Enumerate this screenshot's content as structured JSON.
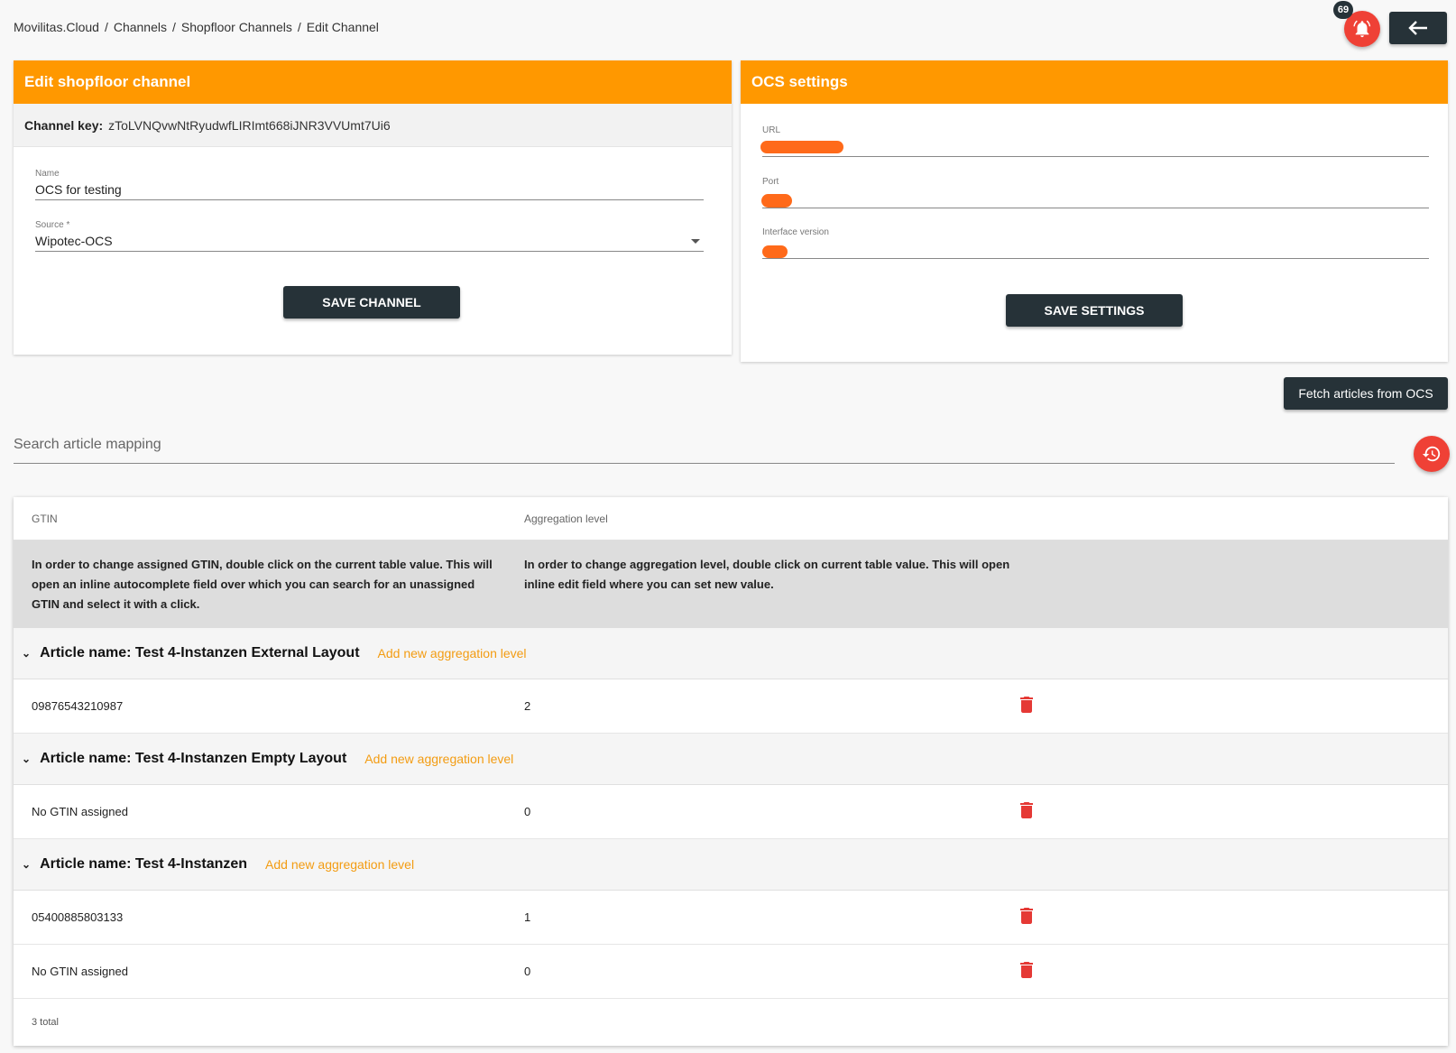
{
  "breadcrumb": [
    "Movilitas.Cloud",
    "Channels",
    "Shopfloor Channels",
    "Edit Channel"
  ],
  "breadcrumb_sep": "/",
  "notifications": {
    "count": "69",
    "icon": "bell-icon"
  },
  "back_icon": "arrow-left-icon",
  "edit_channel": {
    "title": "Edit shopfloor channel",
    "key_label": "Channel key:",
    "key_value": "zToLVNQvwNtRyudwfLIRImt668iJNR3VVUmt7Ui6",
    "name_label": "Name",
    "name_value": "OCS for testing",
    "source_label": "Source *",
    "source_value": "Wipotec-OCS",
    "save_label": "SAVE CHANNEL"
  },
  "ocs": {
    "title": "OCS settings",
    "url_label": "URL",
    "port_label": "Port",
    "version_label": "Interface version",
    "save_label": "SAVE SETTINGS"
  },
  "fetch_label": "Fetch articles from OCS",
  "search": {
    "placeholder": "Search article mapping"
  },
  "history_icon": "history-icon",
  "table": {
    "col_gtin": "GTIN",
    "col_agg": "Aggregation level",
    "info_gtin": "In order to change assigned GTIN, double click on the current table value. This will open an inline autocomplete field over which you can search for an unassigned GTIN and select it with a click.",
    "info_agg": "In order to change aggregation level, double click on current table value. This will open inline edit field where you can set new value.",
    "add_label": "Add new aggregation level",
    "groups": [
      {
        "title": "Article name: Test 4-Instanzen External Layout",
        "rows": [
          {
            "gtin": "09876543210987",
            "level": "2"
          }
        ]
      },
      {
        "title": "Article name: Test 4-Instanzen Empty Layout",
        "rows": [
          {
            "gtin": "No GTIN assigned",
            "level": "0"
          }
        ]
      },
      {
        "title": "Article name: Test 4-Instanzen",
        "rows": [
          {
            "gtin": "05400885803133",
            "level": "1"
          },
          {
            "gtin": "No GTIN assigned",
            "level": "0"
          }
        ]
      }
    ],
    "total": "3 total"
  },
  "colors": {
    "accent": "#ff9800",
    "dark": "#263238",
    "red": "#ef4136",
    "link": "#f39c12"
  }
}
